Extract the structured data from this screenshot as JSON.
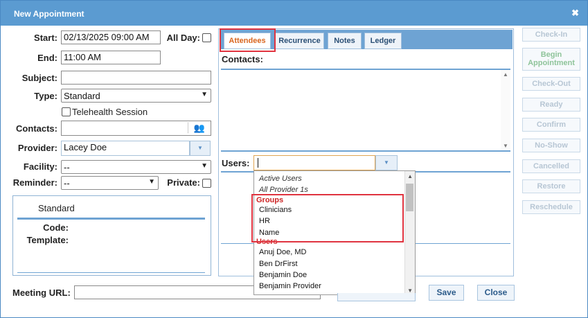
{
  "window": {
    "title": "New Appointment"
  },
  "form": {
    "start_label": "Start:",
    "start_value": "02/13/2025 09:00 AM",
    "allday_label": "All Day:",
    "end_label": "End:",
    "end_value": "11:00 AM",
    "subject_label": "Subject:",
    "subject_value": "",
    "type_label": "Type:",
    "type_value": "Standard",
    "telehealth_label": "Telehealth Session",
    "contacts_label": "Contacts:",
    "provider_label": "Provider:",
    "provider_value": "Lacey Doe",
    "facility_label": "Facility:",
    "facility_value": "--",
    "reminder_label": "Reminder:",
    "reminder_value": "--",
    "private_label": "Private:",
    "meeting_url_label": "Meeting URL:",
    "meeting_url_value": ""
  },
  "type_panel": {
    "title": "Standard",
    "code_label": "Code:",
    "template_label": "Template:"
  },
  "tabs": [
    {
      "label": "Attendees",
      "active": true
    },
    {
      "label": "Recurrence",
      "active": false
    },
    {
      "label": "Notes",
      "active": false
    },
    {
      "label": "Ledger",
      "active": false
    }
  ],
  "attendees": {
    "contacts_label": "Contacts:",
    "users_label": "Users:",
    "users_value": ""
  },
  "dropdown": {
    "items": [
      {
        "label": "Active Users",
        "kind": "italic"
      },
      {
        "label": "All Provider 1s",
        "kind": "italic"
      },
      {
        "label": "Groups",
        "kind": "group"
      },
      {
        "label": "Clinicians",
        "kind": "item"
      },
      {
        "label": "HR",
        "kind": "item"
      },
      {
        "label": "Name",
        "kind": "item"
      },
      {
        "label": "Users",
        "kind": "group"
      },
      {
        "label": "Anuj Doe, MD",
        "kind": "item"
      },
      {
        "label": "Ben DrFirst",
        "kind": "item"
      },
      {
        "label": "Benjamin Doe",
        "kind": "item"
      },
      {
        "label": "Benjamin Provider",
        "kind": "item"
      }
    ]
  },
  "side_actions": [
    "Check-In",
    "Begin Appointment",
    "Check-Out",
    "Ready",
    "Confirm",
    "No-Show",
    "Cancelled",
    "Restore",
    "Reschedule"
  ],
  "footer": {
    "save_label": "Save",
    "close_label": "Close"
  },
  "colors": {
    "titlebar": "#5b9bd1",
    "highlight": "#e0333f",
    "active_tab_text": "#d9661f",
    "group_text": "#cc2424"
  }
}
